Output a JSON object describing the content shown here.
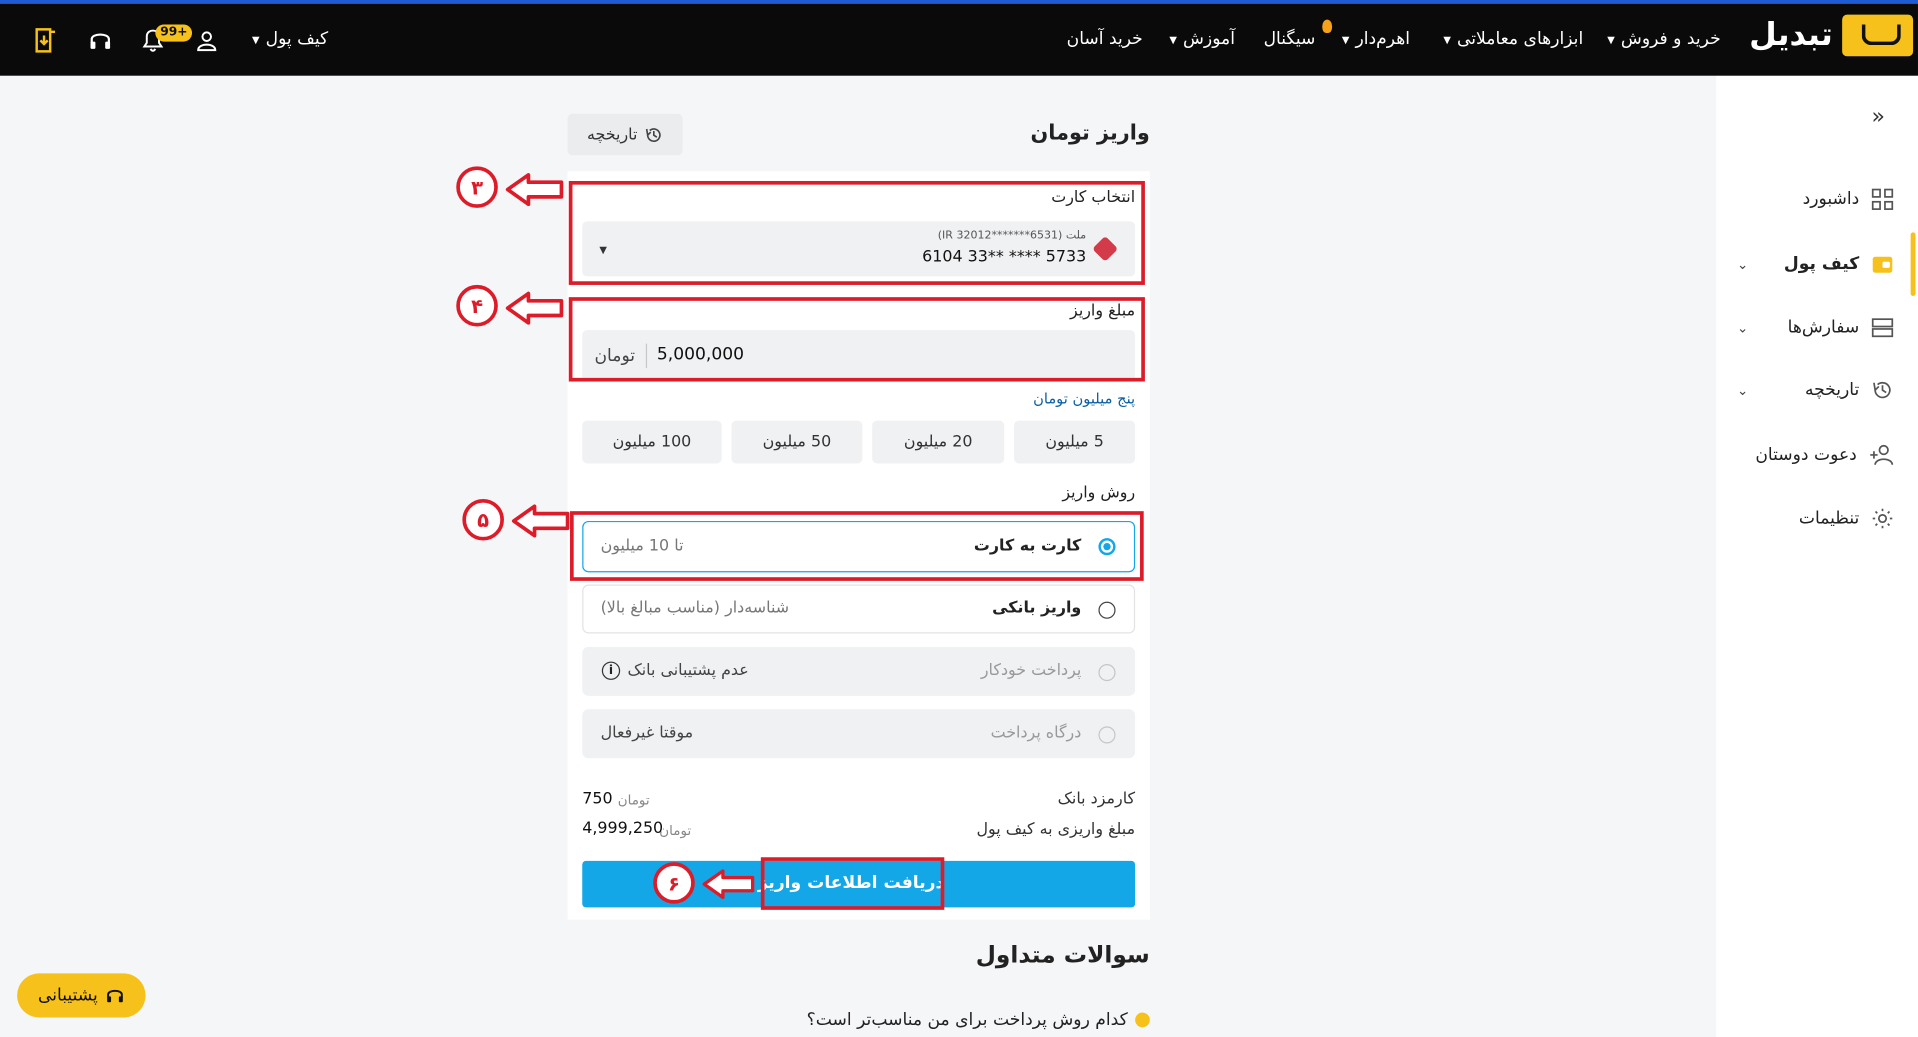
{
  "header": {
    "brand": "تبدیل",
    "nav": [
      {
        "label": "خرید و فروش",
        "has_caret": true
      },
      {
        "label": "ابزارهای معاملاتی",
        "has_caret": true
      },
      {
        "label": "اهرم‌دار",
        "has_caret": true
      },
      {
        "label": "سیگنال",
        "badge_icon": "fire-icon"
      },
      {
        "label": "آموزش",
        "has_caret": true
      },
      {
        "label": "خرید آسان",
        "has_caret": false
      }
    ],
    "wallet_label": "کیف پول",
    "notif_badge": "99+"
  },
  "sidebar": {
    "items": [
      {
        "label": "داشبورد",
        "icon": "grid-icon"
      },
      {
        "label": "کیف پول",
        "icon": "wallet-icon",
        "active": true
      },
      {
        "label": "سفارش‌ها",
        "icon": "orders-icon"
      },
      {
        "label": "تاریخچه",
        "icon": "history-icon"
      },
      {
        "label": "دعوت دوستان",
        "icon": "add-user-icon"
      },
      {
        "label": "تنظیمات",
        "icon": "gear-icon"
      }
    ]
  },
  "deposit": {
    "title": "واریز تومان",
    "history_button": "تاریخچه",
    "card_select_label": "انتخاب کارت",
    "card_bank": "ملت",
    "card_iban": "(IR 32012*******6531)",
    "card_number": "6104 33** **** 5733",
    "amount_label": "مبلغ واریز",
    "amount_value": "5,000,000",
    "amount_unit": "تومان",
    "amount_words": "پنج میلیون تومان",
    "presets": [
      "5 میلیون",
      "20 میلیون",
      "50 میلیون",
      "100 میلیون"
    ],
    "method_label": "روش واریز",
    "methods": [
      {
        "name": "کارت به کارت",
        "note": "تا 10 میلیون",
        "state": "selected"
      },
      {
        "name": "واریز بانکی",
        "note": "شناسه‌دار (مناسب مبالغ بالا)",
        "state": "enabled"
      },
      {
        "name": "پرداخت خودکار",
        "note": "عدم پشتیبانی بانک",
        "state": "disabled"
      },
      {
        "name": "درگاه پرداخت",
        "note": "موقتا غیرفعال",
        "state": "disabled"
      }
    ],
    "fee_label": "کارمزد بانک",
    "fee_value": "750",
    "fee_unit": "تومان",
    "net_label": "مبلغ واریزی به کیف پول",
    "net_value": "4,999,250",
    "net_unit": "تومان",
    "submit": "دریافت اطلاعات واریز"
  },
  "annotations": [
    "۳",
    "۴",
    "۵",
    "۶"
  ],
  "faq": {
    "title": "سوالات متداول",
    "q1": "کدام روش پرداخت برای من مناسب‌تر است؟"
  },
  "support_button": "پشتیبانی",
  "colors": {
    "accent": "#f6c11a",
    "primary": "#14a7e8",
    "annotation": "#dd1c2a",
    "topbar": "#0a0a0a"
  }
}
